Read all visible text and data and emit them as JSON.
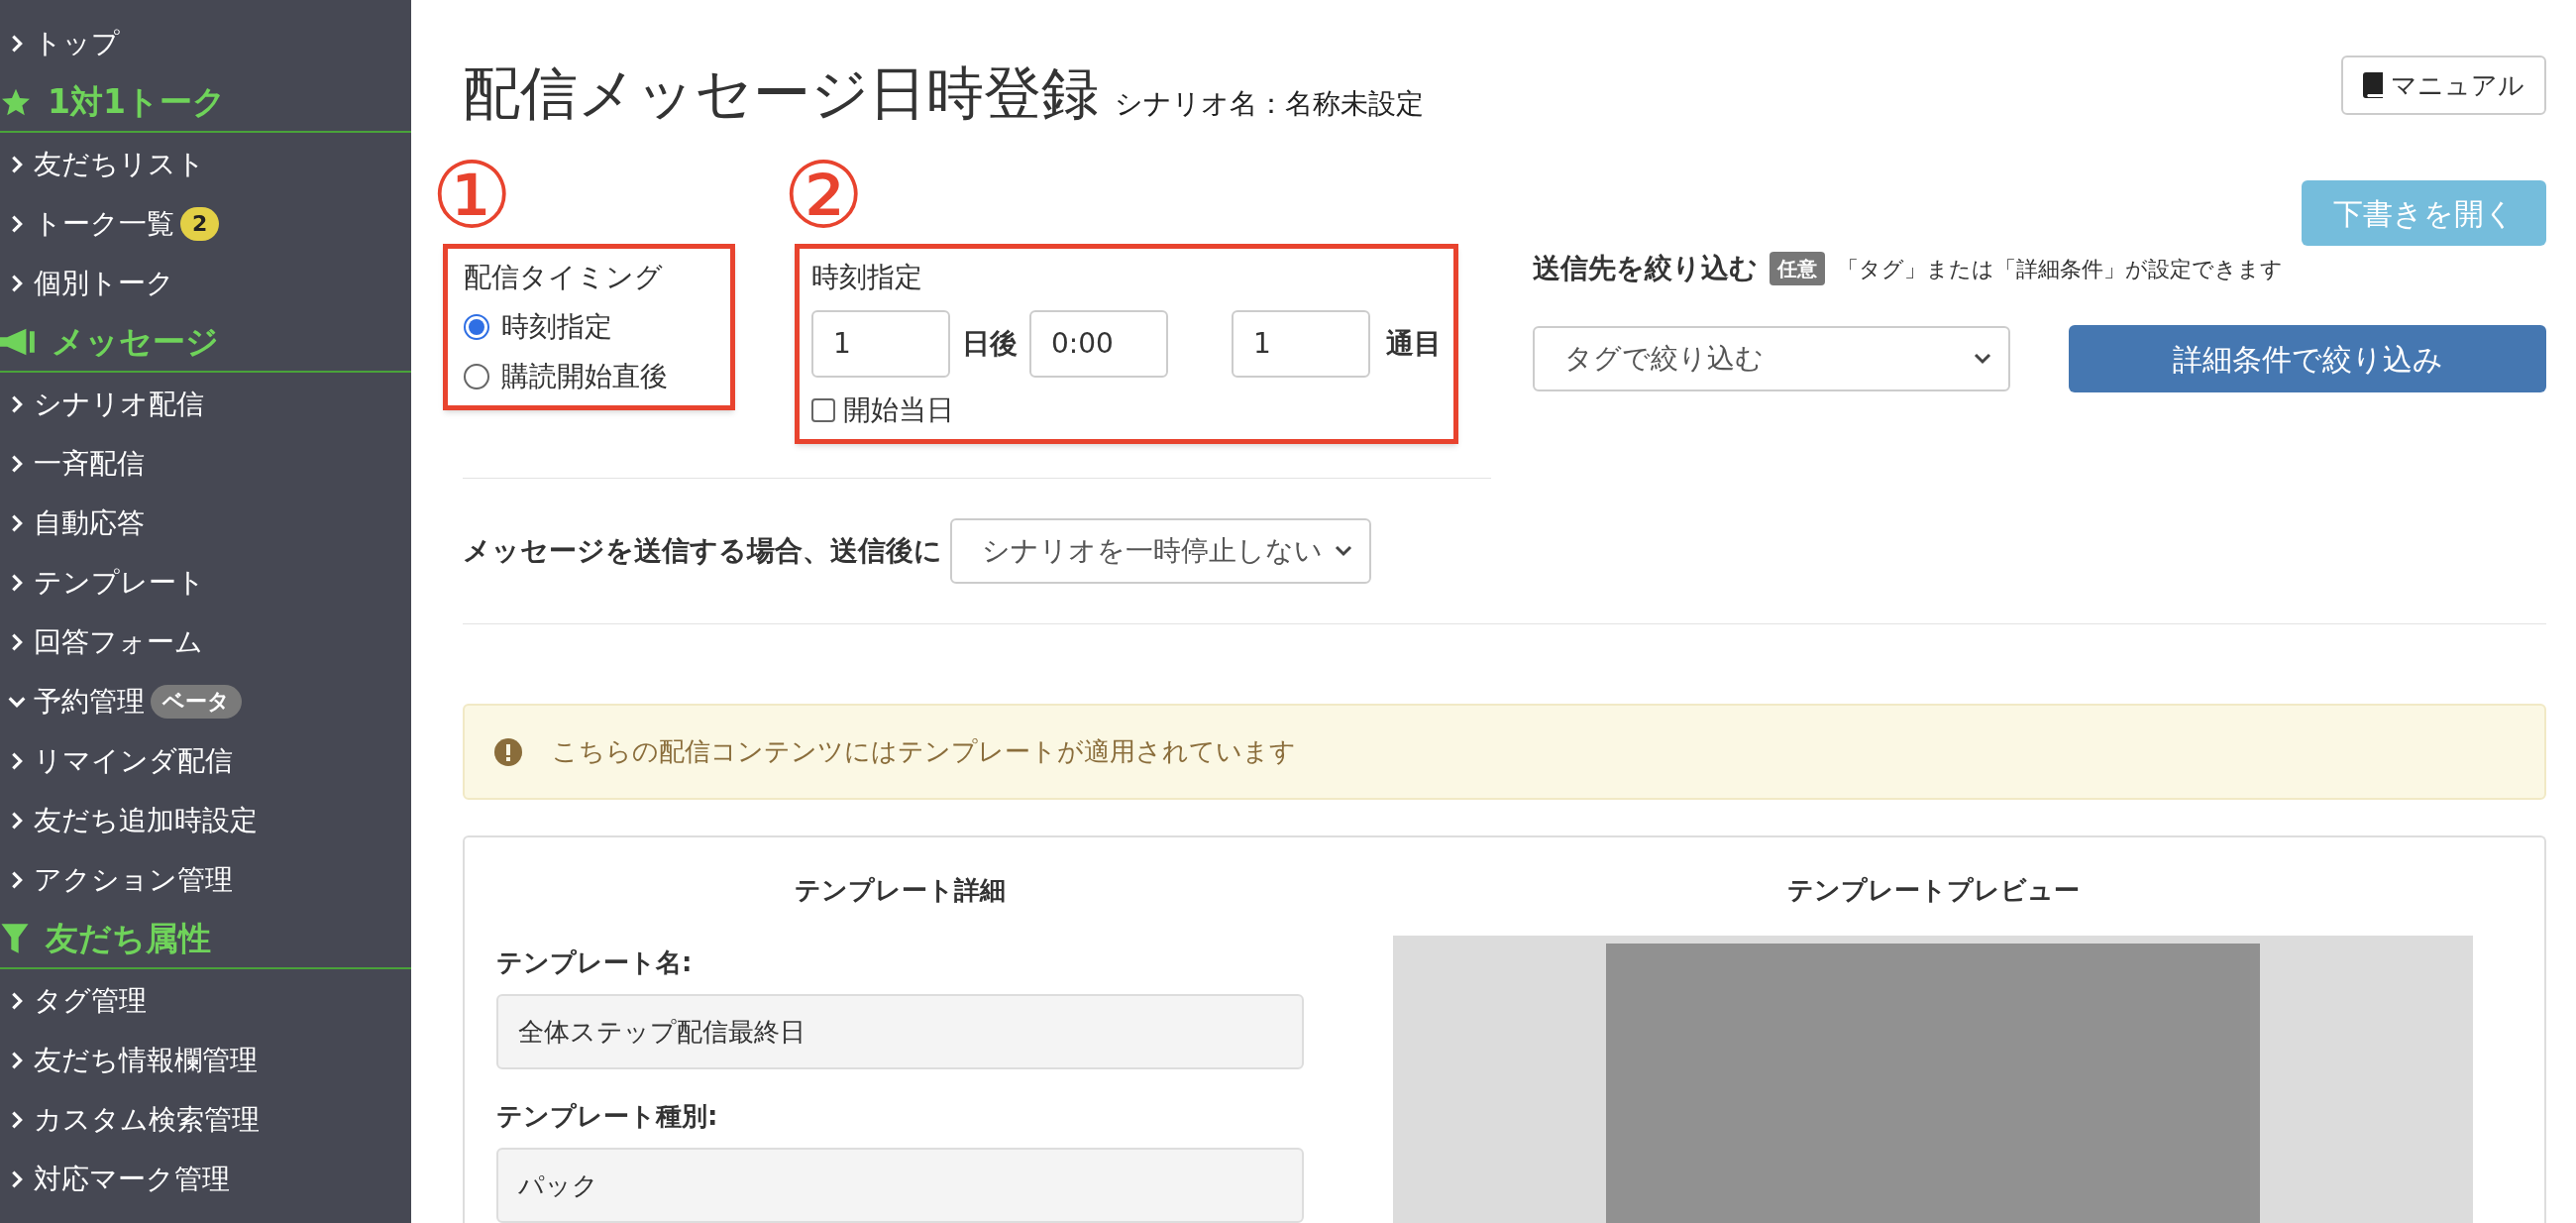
{
  "sidebar": {
    "items": [
      {
        "kind": "link",
        "label": "トップ",
        "expanded": false
      },
      {
        "kind": "heading",
        "label": "1対1トーク"
      },
      {
        "kind": "link",
        "label": "友だちリスト",
        "expanded": false
      },
      {
        "kind": "link",
        "label": "トーク一覧",
        "expanded": false,
        "badge": {
          "text": "2",
          "color": "#e3d046"
        }
      },
      {
        "kind": "link",
        "label": "個別トーク",
        "expanded": false
      },
      {
        "kind": "heading",
        "label": "メッセージ"
      },
      {
        "kind": "link",
        "label": "シナリオ配信",
        "expanded": false
      },
      {
        "kind": "link",
        "label": "一斉配信",
        "expanded": false
      },
      {
        "kind": "link",
        "label": "自動応答",
        "expanded": false
      },
      {
        "kind": "link",
        "label": "テンプレート",
        "expanded": false
      },
      {
        "kind": "link",
        "label": "回答フォーム",
        "expanded": false
      },
      {
        "kind": "link",
        "label": "予約管理",
        "expanded": true,
        "badge": {
          "text": "ベータ",
          "color": "#7a7a7a"
        }
      },
      {
        "kind": "link",
        "label": "リマインダ配信",
        "expanded": false
      },
      {
        "kind": "link",
        "label": "友だち追加時設定",
        "expanded": false
      },
      {
        "kind": "link",
        "label": "アクション管理",
        "expanded": false
      },
      {
        "kind": "heading",
        "label": "友だち属性"
      },
      {
        "kind": "link",
        "label": "タグ管理",
        "expanded": false
      },
      {
        "kind": "link",
        "label": "友だち情報欄管理",
        "expanded": false
      },
      {
        "kind": "link",
        "label": "カスタム検索管理",
        "expanded": false
      },
      {
        "kind": "link",
        "label": "対応マーク管理",
        "expanded": false
      }
    ]
  },
  "page": {
    "title": "配信メッセージ日時登録",
    "subtitle": "シナリオ名：名称未設定",
    "manual_button": "マニュアル"
  },
  "timing": {
    "marker": "①",
    "label": "配信タイミング",
    "options": [
      {
        "label": "時刻指定",
        "selected": true
      },
      {
        "label": "購読開始直後",
        "selected": false
      }
    ]
  },
  "time_spec": {
    "marker": "②",
    "label": "時刻指定",
    "days": "1",
    "days_unit": "日後",
    "time": "0:00",
    "count": "1",
    "count_unit": "通目",
    "same_day": {
      "label": "開始当日",
      "checked": false
    }
  },
  "after_send": {
    "label": "メッセージを送信する場合、送信後に",
    "value": "シナリオを一時停止しない"
  },
  "filter": {
    "draft_button": "下書きを開く",
    "label": "送信先を絞り込む",
    "tag": "任意",
    "hint": "「タグ」または「詳細条件」が設定できます",
    "tag_select": "タグで絞り込む",
    "detail_button": "詳細条件で絞り込み"
  },
  "alert": {
    "text": "こちらの配信コンテンツにはテンプレートが適用されています"
  },
  "template": {
    "detail_heading": "テンプレート詳細",
    "preview_heading": "テンプレートプレビュー",
    "fields": [
      {
        "label": "テンプレート名:",
        "value": "全体ステップ配信最終日"
      },
      {
        "label": "テンプレート種別:",
        "value": "パック"
      }
    ]
  }
}
